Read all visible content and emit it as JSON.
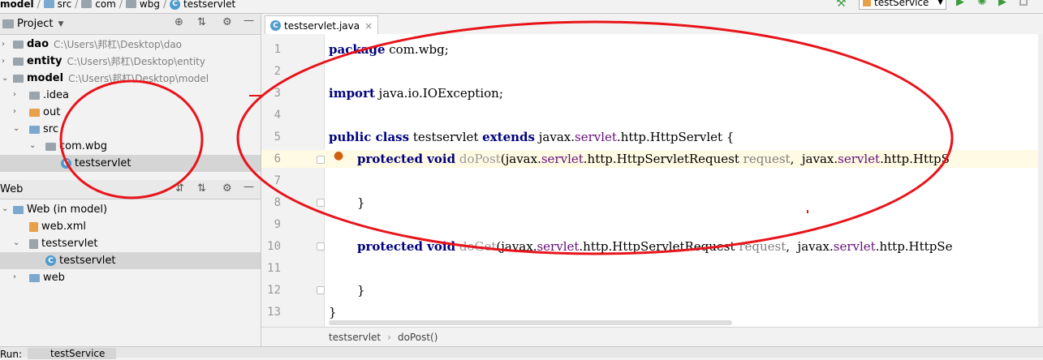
{
  "breadcrumb": {
    "items": [
      "model",
      "src",
      "com",
      "wbg",
      "testservlet"
    ]
  },
  "toolbar": {
    "run_config": "testService"
  },
  "project_panel": {
    "title": "Project",
    "tree": [
      {
        "label": "dao",
        "path": "C:\\Users\\邦杠\\Desktop\\dao"
      },
      {
        "label": "entity",
        "path": "C:\\Users\\邦杠\\Desktop\\entity"
      },
      {
        "label": "model",
        "path": "C:\\Users\\邦杠\\Desktop\\model"
      },
      {
        "label": ".idea"
      },
      {
        "label": "out"
      },
      {
        "label": "src"
      },
      {
        "label": "com.wbg"
      },
      {
        "label": "testservlet"
      }
    ]
  },
  "web_panel": {
    "title": "Web",
    "tree": [
      {
        "label": "Web (in model)"
      },
      {
        "label": "web.xml"
      },
      {
        "label": "testservlet"
      },
      {
        "label": "testservlet"
      },
      {
        "label": "web"
      }
    ]
  },
  "editor": {
    "tab_label": "testservlet.java",
    "line_numbers": [
      "1",
      "2",
      "3",
      "4",
      "5",
      "6",
      "7",
      "8",
      "9",
      "10",
      "11",
      "12",
      "13"
    ],
    "lines": {
      "l1_kw": "package",
      "l1_rest": " com.wbg;",
      "l3_kw": "import",
      "l3_rest": " java.io.IOException;",
      "l5_kw1": "public class",
      "l5_name": " testservlet ",
      "l5_kw2": "extends",
      "l5_a": " javax.",
      "l5_b": "servlet",
      "l5_c": ".http.HttpServlet {",
      "l6_kw": "protected void",
      "l6_meth": " doPost",
      "l6_a": "(javax.",
      "l6_b": "servlet",
      "l6_c": ".http.HttpServletRequest ",
      "l6_p": "request",
      "l6_d": ",  javax.",
      "l6_e": "servlet",
      "l6_f": ".http.HttpS",
      "l8": "}",
      "l10_kw": "protected void",
      "l10_meth": " doGet",
      "l10_a": "(javax.",
      "l10_b": "servlet",
      "l10_c": ".http.HttpServletRequest ",
      "l10_p": "request",
      "l10_d": ",  javax.",
      "l10_e": "servlet",
      "l10_f": ".http.HttpSe",
      "l12": "}",
      "l13": "}"
    }
  },
  "status": {
    "crumb1": "testservlet",
    "crumb2": "doPost()"
  },
  "bottom": {
    "tab_prefix": "Run:",
    "tab": "testService"
  },
  "colors": {
    "annotation": "#e8141b",
    "keyword": "#000080",
    "package": "#660e7a"
  }
}
